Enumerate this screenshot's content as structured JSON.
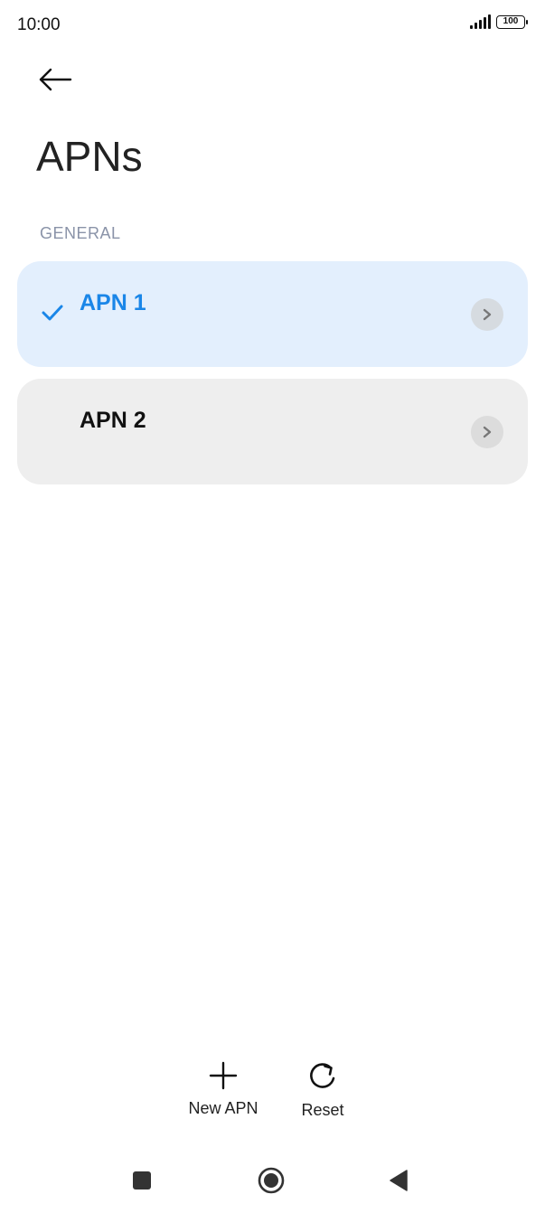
{
  "status_bar": {
    "time": "10:00",
    "battery": "100"
  },
  "header": {
    "title": "APNs",
    "back_icon": "arrow-left-icon"
  },
  "section": {
    "label": "GENERAL"
  },
  "apn_list": [
    {
      "label": "APN 1",
      "selected": true,
      "icon": "checkmark-icon"
    },
    {
      "label": "APN 2",
      "selected": false
    }
  ],
  "actions": {
    "new_apn": {
      "label": "New APN",
      "icon": "plus-icon"
    },
    "reset": {
      "label": "Reset",
      "icon": "refresh-icon"
    }
  },
  "nav_bar": {
    "recents_icon": "square-icon",
    "home_icon": "circle-icon",
    "back_icon": "triangle-back-icon"
  },
  "colors": {
    "accent": "#1a86e8",
    "selected_bg": "#e3effd",
    "item_bg": "#eeeeee",
    "section_text": "#8a93a8"
  }
}
